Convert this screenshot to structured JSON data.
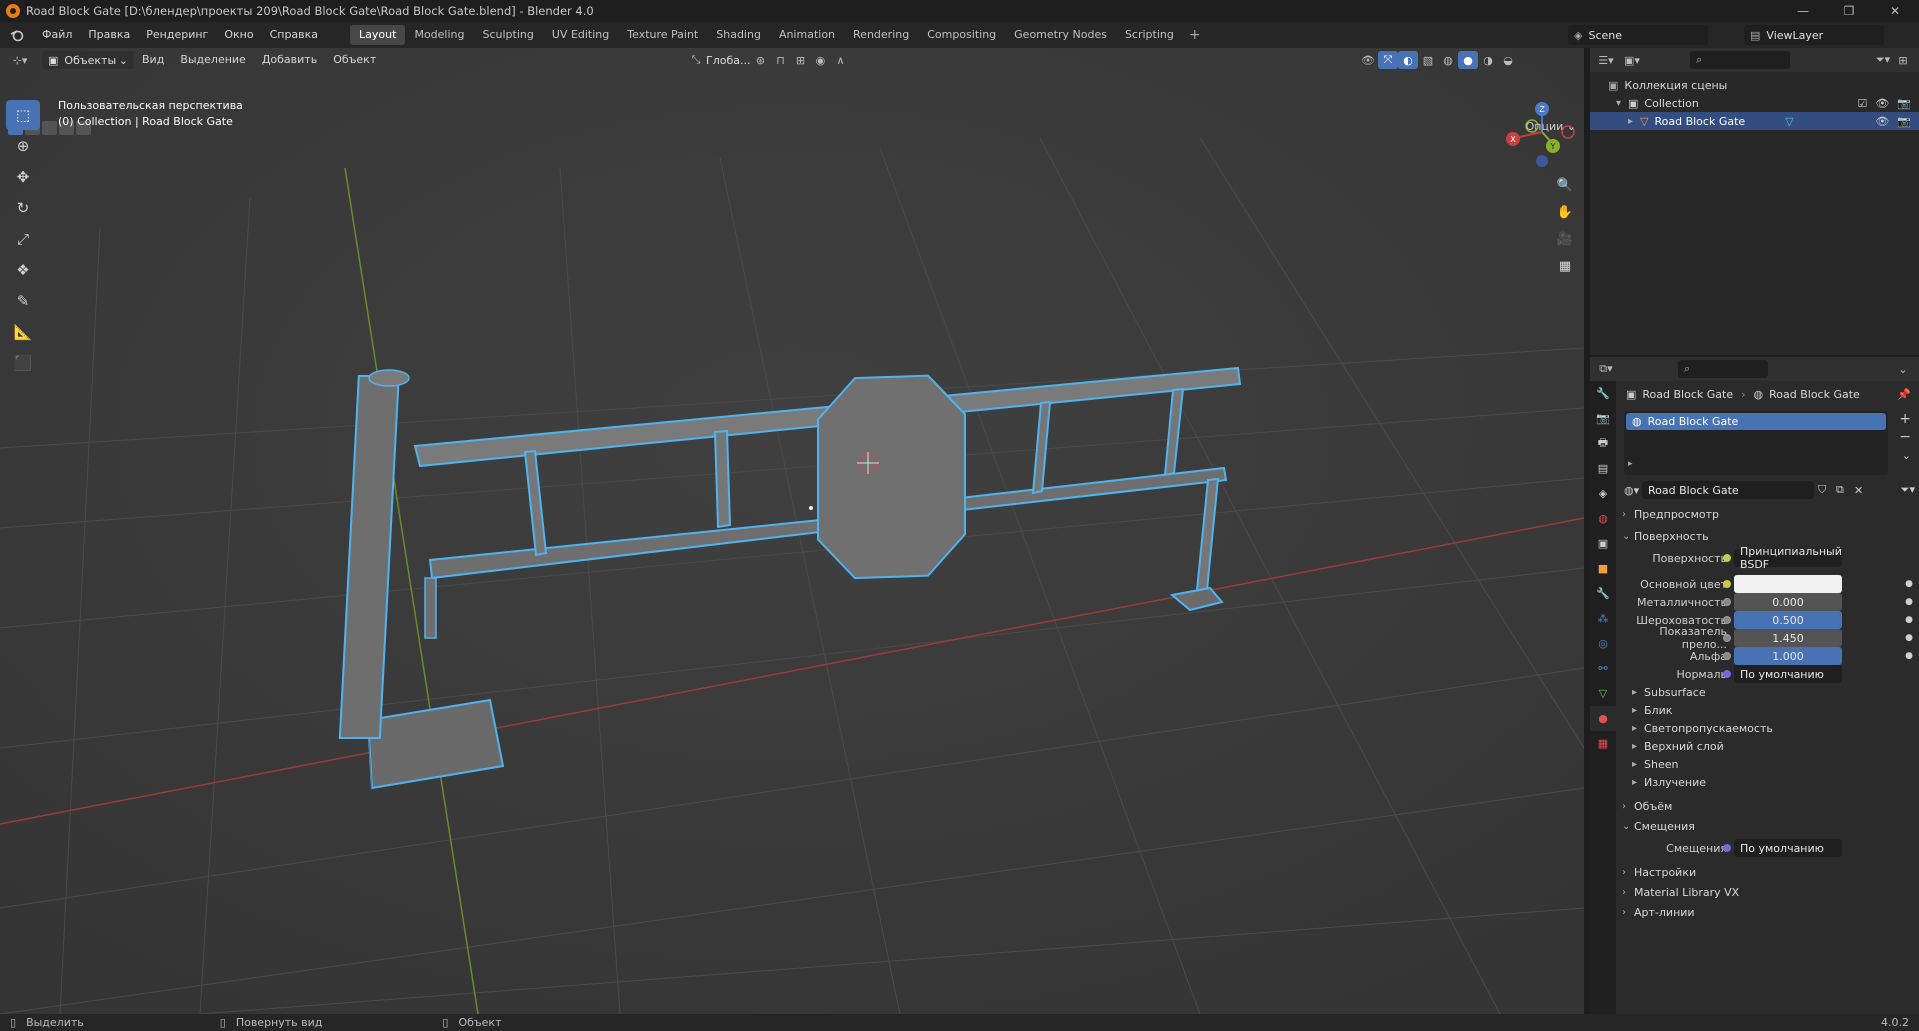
{
  "window": {
    "title": "Road Block Gate [D:\\блендер\\проекты 209\\Road Block Gate\\Road Block Gate.blend] - Blender 4.0"
  },
  "menu": [
    "Файл",
    "Правка",
    "Рендеринг",
    "Окно",
    "Справка"
  ],
  "workspaces": [
    "Layout",
    "Modeling",
    "Sculpting",
    "UV Editing",
    "Texture Paint",
    "Shading",
    "Animation",
    "Rendering",
    "Compositing",
    "Geometry Nodes",
    "Scripting"
  ],
  "active_workspace": "Layout",
  "scene": "Scene",
  "view_layer": "ViewLayer",
  "viewport": {
    "mode": "Объекты",
    "menu": [
      "Вид",
      "Выделение",
      "Добавить",
      "Объект"
    ],
    "transform_orientation": "Глоба...",
    "options": "Опции",
    "view_name": "Пользовательская перспектива",
    "collection_info": "(0) Collection | Road Block Gate",
    "gizmo_labels": {
      "x": "X",
      "y": "Y",
      "z": "Z"
    }
  },
  "outliner": {
    "scene_collection": "Коллекция сцены",
    "collection": "Collection",
    "object": "Road Block Gate"
  },
  "properties": {
    "breadcrumb_object": "Road Block Gate",
    "breadcrumb_material": "Road Block Gate",
    "slot": "Road Block Gate",
    "material_name": "Road Block Gate",
    "sections": {
      "preview": "Предпросмотр",
      "surface": "Поверхность",
      "volume": "Объём",
      "displacement": "Смещения",
      "settings": "Настройки",
      "material_library": "Material Library VX",
      "line_art": "Арт-линии"
    },
    "surface_label": "Поверхность",
    "surface_value": "Принципиальный BSDF",
    "params": [
      {
        "label": "Основной цвет",
        "value": ""
      },
      {
        "label": "Металличность",
        "value": "0.000"
      },
      {
        "label": "Шероховатость",
        "value": "0.500"
      },
      {
        "label": "Показатель прело...",
        "value": "1.450"
      },
      {
        "label": "Альфа",
        "value": "1.000"
      },
      {
        "label": "Нормаль",
        "value": "По умолчанию"
      }
    ],
    "subpanels": [
      "Subsurface",
      "Блик",
      "Светопропускаемость",
      "Верхний слой",
      "Sheen",
      "Излучение"
    ],
    "displacement_label": "Смещения",
    "displacement_value": "По умолчанию"
  },
  "status": {
    "select": "Выделить",
    "rotate": "Повернуть вид",
    "object": "Объект",
    "version": "4.0.2"
  },
  "colors": {
    "accent": "#4772b3",
    "selection_outline": "#4fb3f0",
    "x_axis": "#c93c3c",
    "y_axis": "#7aa32a"
  }
}
